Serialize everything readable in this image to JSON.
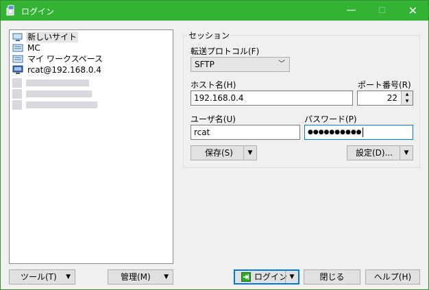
{
  "window": {
    "title": "ログイン",
    "minimize": "—",
    "maximize": "☐",
    "close": "✕"
  },
  "sitetree": {
    "items": [
      {
        "label": "新しいサイト",
        "icon": "new-site-icon",
        "selected": true
      },
      {
        "label": "MC",
        "icon": "folder-site-icon"
      },
      {
        "label": "マイ ワークスペース",
        "icon": "folder-site-icon"
      },
      {
        "label": "rcat@192.168.0.4",
        "icon": "computer-icon"
      }
    ]
  },
  "left_buttons": {
    "tools": "ツール(T)",
    "manage": "管理(M)"
  },
  "session": {
    "group_title": "セッション",
    "protocol_label": "転送プロトコル(F)",
    "protocol_value": "SFTP",
    "host_label": "ホスト名(H)",
    "host_value": "192.168.0.4",
    "port_label": "ポート番号(R)",
    "port_value": "22",
    "user_label": "ユーザ名(U)",
    "user_value": "rcat",
    "password_label": "パスワード(P)",
    "password_value": "●●●●●●●●●●",
    "save_button": "保存(S)",
    "settings_button": "設定(D)..."
  },
  "bottom_buttons": {
    "login": "ログイン",
    "close": "閉じる",
    "help": "ヘルプ(H)"
  },
  "colors": {
    "titlebar": "#34b234",
    "accent": "#0078d7"
  }
}
